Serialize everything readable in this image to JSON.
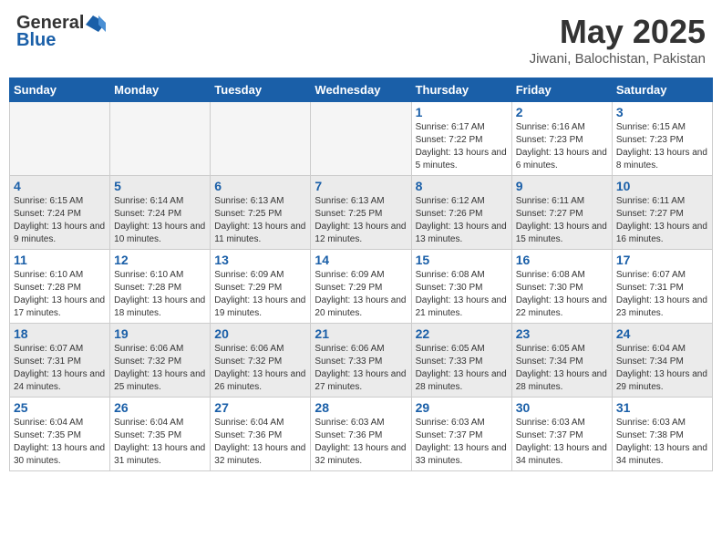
{
  "header": {
    "logo_general": "General",
    "logo_blue": "Blue",
    "month_year": "May 2025",
    "location": "Jiwani, Balochistan, Pakistan"
  },
  "weekdays": [
    "Sunday",
    "Monday",
    "Tuesday",
    "Wednesday",
    "Thursday",
    "Friday",
    "Saturday"
  ],
  "weeks": [
    {
      "days": [
        {
          "num": "",
          "empty": true
        },
        {
          "num": "",
          "empty": true
        },
        {
          "num": "",
          "empty": true
        },
        {
          "num": "",
          "empty": true
        },
        {
          "num": "1",
          "sunrise": "Sunrise: 6:17 AM",
          "sunset": "Sunset: 7:22 PM",
          "daylight": "Daylight: 13 hours and 5 minutes."
        },
        {
          "num": "2",
          "sunrise": "Sunrise: 6:16 AM",
          "sunset": "Sunset: 7:23 PM",
          "daylight": "Daylight: 13 hours and 6 minutes."
        },
        {
          "num": "3",
          "sunrise": "Sunrise: 6:15 AM",
          "sunset": "Sunset: 7:23 PM",
          "daylight": "Daylight: 13 hours and 8 minutes."
        }
      ]
    },
    {
      "days": [
        {
          "num": "4",
          "sunrise": "Sunrise: 6:15 AM",
          "sunset": "Sunset: 7:24 PM",
          "daylight": "Daylight: 13 hours and 9 minutes."
        },
        {
          "num": "5",
          "sunrise": "Sunrise: 6:14 AM",
          "sunset": "Sunset: 7:24 PM",
          "daylight": "Daylight: 13 hours and 10 minutes."
        },
        {
          "num": "6",
          "sunrise": "Sunrise: 6:13 AM",
          "sunset": "Sunset: 7:25 PM",
          "daylight": "Daylight: 13 hours and 11 minutes."
        },
        {
          "num": "7",
          "sunrise": "Sunrise: 6:13 AM",
          "sunset": "Sunset: 7:25 PM",
          "daylight": "Daylight: 13 hours and 12 minutes."
        },
        {
          "num": "8",
          "sunrise": "Sunrise: 6:12 AM",
          "sunset": "Sunset: 7:26 PM",
          "daylight": "Daylight: 13 hours and 13 minutes."
        },
        {
          "num": "9",
          "sunrise": "Sunrise: 6:11 AM",
          "sunset": "Sunset: 7:27 PM",
          "daylight": "Daylight: 13 hours and 15 minutes."
        },
        {
          "num": "10",
          "sunrise": "Sunrise: 6:11 AM",
          "sunset": "Sunset: 7:27 PM",
          "daylight": "Daylight: 13 hours and 16 minutes."
        }
      ]
    },
    {
      "days": [
        {
          "num": "11",
          "sunrise": "Sunrise: 6:10 AM",
          "sunset": "Sunset: 7:28 PM",
          "daylight": "Daylight: 13 hours and 17 minutes."
        },
        {
          "num": "12",
          "sunrise": "Sunrise: 6:10 AM",
          "sunset": "Sunset: 7:28 PM",
          "daylight": "Daylight: 13 hours and 18 minutes."
        },
        {
          "num": "13",
          "sunrise": "Sunrise: 6:09 AM",
          "sunset": "Sunset: 7:29 PM",
          "daylight": "Daylight: 13 hours and 19 minutes."
        },
        {
          "num": "14",
          "sunrise": "Sunrise: 6:09 AM",
          "sunset": "Sunset: 7:29 PM",
          "daylight": "Daylight: 13 hours and 20 minutes."
        },
        {
          "num": "15",
          "sunrise": "Sunrise: 6:08 AM",
          "sunset": "Sunset: 7:30 PM",
          "daylight": "Daylight: 13 hours and 21 minutes."
        },
        {
          "num": "16",
          "sunrise": "Sunrise: 6:08 AM",
          "sunset": "Sunset: 7:30 PM",
          "daylight": "Daylight: 13 hours and 22 minutes."
        },
        {
          "num": "17",
          "sunrise": "Sunrise: 6:07 AM",
          "sunset": "Sunset: 7:31 PM",
          "daylight": "Daylight: 13 hours and 23 minutes."
        }
      ]
    },
    {
      "days": [
        {
          "num": "18",
          "sunrise": "Sunrise: 6:07 AM",
          "sunset": "Sunset: 7:31 PM",
          "daylight": "Daylight: 13 hours and 24 minutes."
        },
        {
          "num": "19",
          "sunrise": "Sunrise: 6:06 AM",
          "sunset": "Sunset: 7:32 PM",
          "daylight": "Daylight: 13 hours and 25 minutes."
        },
        {
          "num": "20",
          "sunrise": "Sunrise: 6:06 AM",
          "sunset": "Sunset: 7:32 PM",
          "daylight": "Daylight: 13 hours and 26 minutes."
        },
        {
          "num": "21",
          "sunrise": "Sunrise: 6:06 AM",
          "sunset": "Sunset: 7:33 PM",
          "daylight": "Daylight: 13 hours and 27 minutes."
        },
        {
          "num": "22",
          "sunrise": "Sunrise: 6:05 AM",
          "sunset": "Sunset: 7:33 PM",
          "daylight": "Daylight: 13 hours and 28 minutes."
        },
        {
          "num": "23",
          "sunrise": "Sunrise: 6:05 AM",
          "sunset": "Sunset: 7:34 PM",
          "daylight": "Daylight: 13 hours and 28 minutes."
        },
        {
          "num": "24",
          "sunrise": "Sunrise: 6:04 AM",
          "sunset": "Sunset: 7:34 PM",
          "daylight": "Daylight: 13 hours and 29 minutes."
        }
      ]
    },
    {
      "days": [
        {
          "num": "25",
          "sunrise": "Sunrise: 6:04 AM",
          "sunset": "Sunset: 7:35 PM",
          "daylight": "Daylight: 13 hours and 30 minutes."
        },
        {
          "num": "26",
          "sunrise": "Sunrise: 6:04 AM",
          "sunset": "Sunset: 7:35 PM",
          "daylight": "Daylight: 13 hours and 31 minutes."
        },
        {
          "num": "27",
          "sunrise": "Sunrise: 6:04 AM",
          "sunset": "Sunset: 7:36 PM",
          "daylight": "Daylight: 13 hours and 32 minutes."
        },
        {
          "num": "28",
          "sunrise": "Sunrise: 6:03 AM",
          "sunset": "Sunset: 7:36 PM",
          "daylight": "Daylight: 13 hours and 32 minutes."
        },
        {
          "num": "29",
          "sunrise": "Sunrise: 6:03 AM",
          "sunset": "Sunset: 7:37 PM",
          "daylight": "Daylight: 13 hours and 33 minutes."
        },
        {
          "num": "30",
          "sunrise": "Sunrise: 6:03 AM",
          "sunset": "Sunset: 7:37 PM",
          "daylight": "Daylight: 13 hours and 34 minutes."
        },
        {
          "num": "31",
          "sunrise": "Sunrise: 6:03 AM",
          "sunset": "Sunset: 7:38 PM",
          "daylight": "Daylight: 13 hours and 34 minutes."
        }
      ]
    }
  ]
}
